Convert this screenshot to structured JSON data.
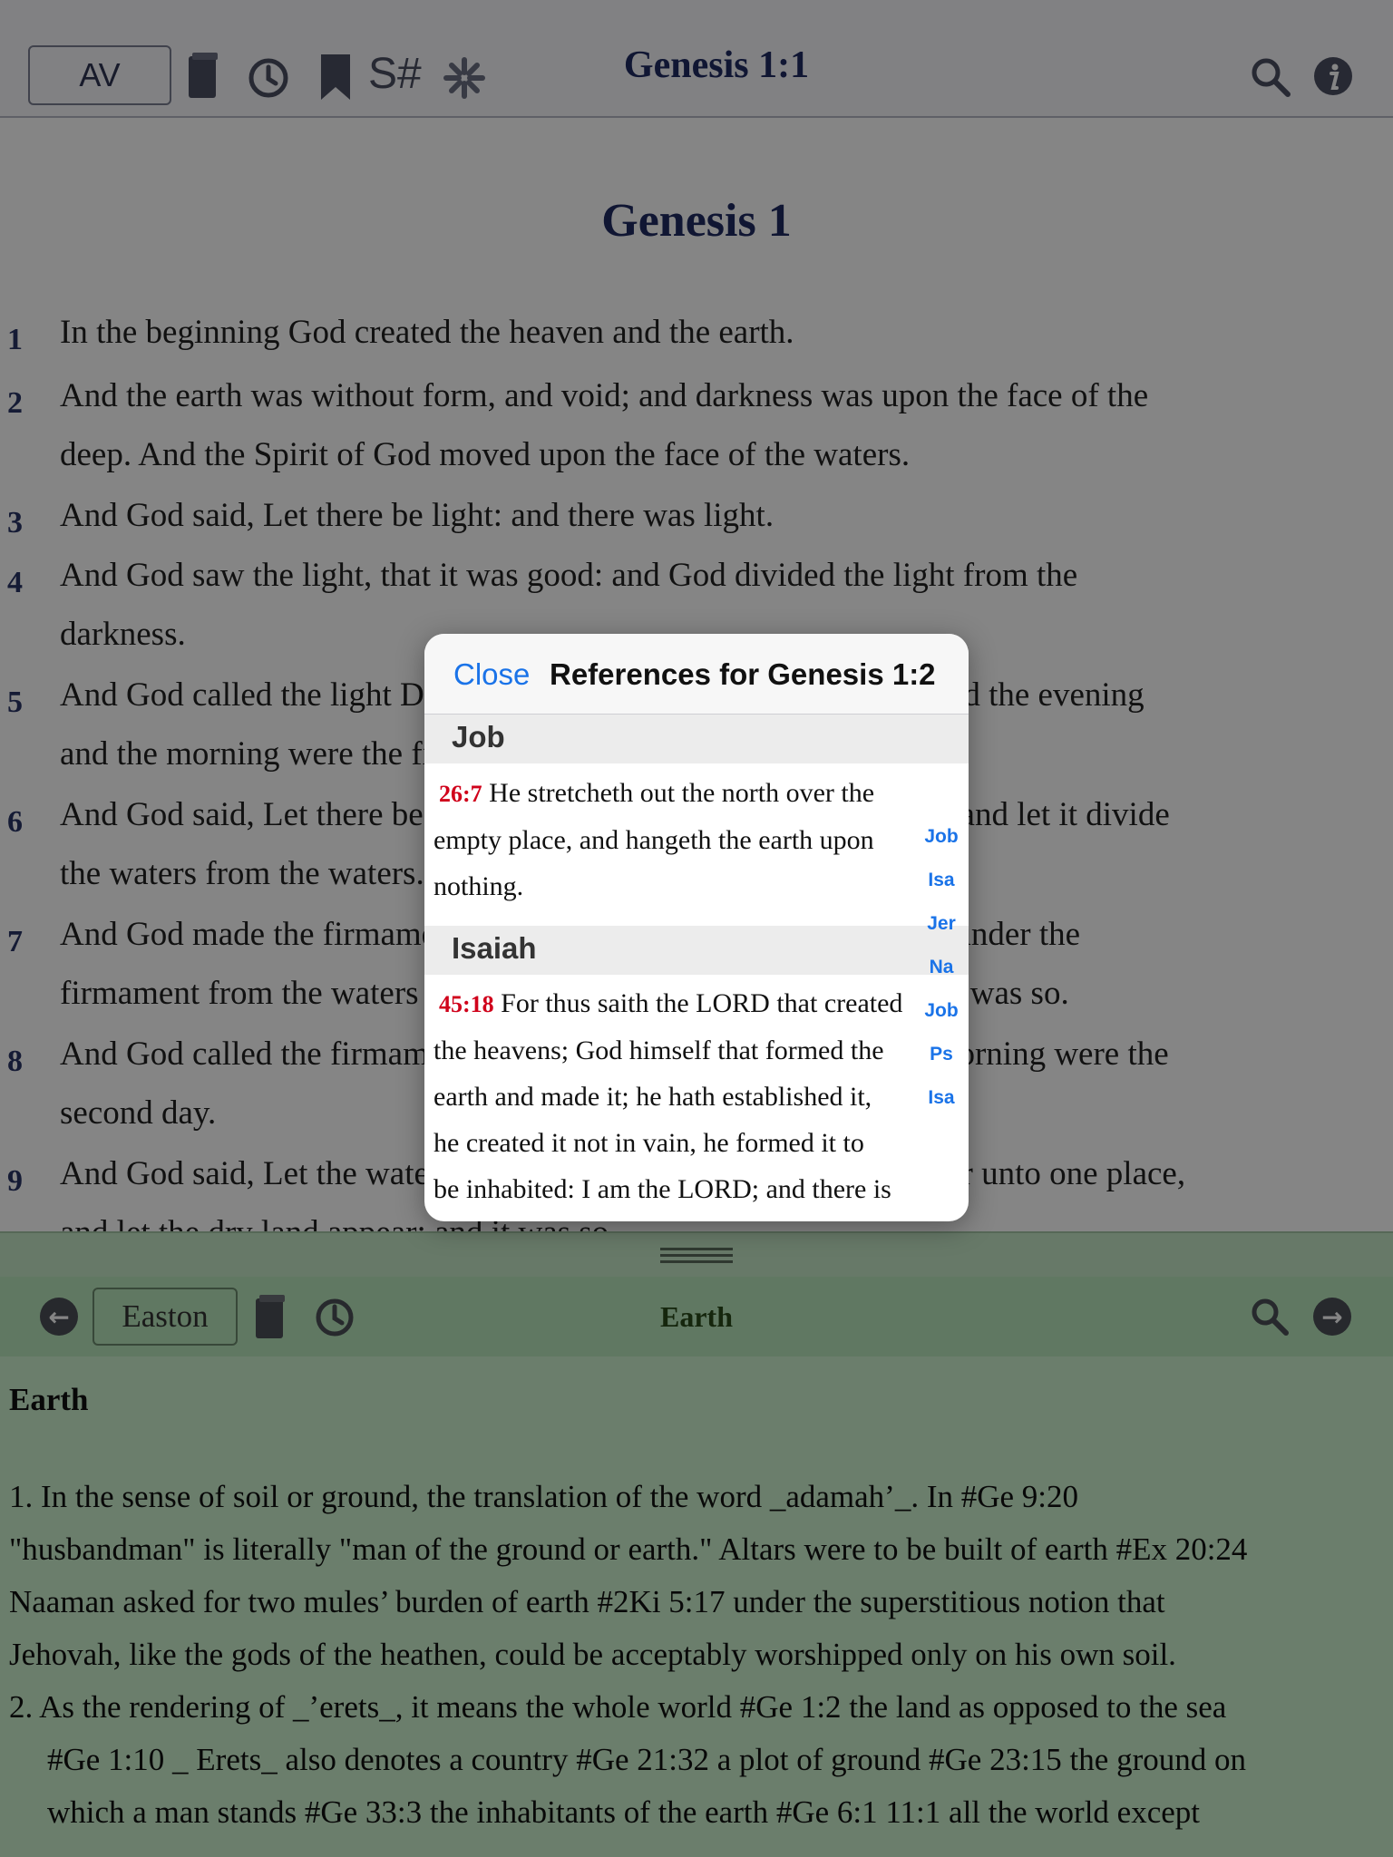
{
  "top_toolbar": {
    "version_label": "AV",
    "title": "Genesis 1:1",
    "icons": [
      "book-icon",
      "history-icon",
      "bookmark-icon",
      "strongs-icon",
      "asterisk-icon",
      "search-icon",
      "info-icon"
    ],
    "strongs_label": "S#"
  },
  "chapter": {
    "title": "Genesis 1",
    "verses": [
      {
        "num": "1",
        "lines": [
          "In the beginning God created the heaven and the earth."
        ]
      },
      {
        "num": "2",
        "lines": [
          "And the earth was without form, and void; and darkness was upon the face of the",
          "deep. And the Spirit of God moved upon the face of the waters."
        ]
      },
      {
        "num": "3",
        "lines": [
          "And God said, Let there be light: and there was light."
        ]
      },
      {
        "num": "4",
        "lines": [
          "And God saw the light, that it was good: and God divided the light from the",
          "darkness."
        ]
      },
      {
        "num": "5",
        "lines": [
          "And God called the light Day, and the darkness he called Night. And the evening",
          "and the morning were the first day."
        ]
      },
      {
        "num": "6",
        "lines": [
          "And God said, Let there be a firmament in the midst of the waters, and let it divide",
          "the waters from the waters."
        ]
      },
      {
        "num": "7",
        "lines": [
          "And God made the firmament, and divided the waters which were under the",
          "firmament from the waters which were above the firmament: and it was so."
        ]
      },
      {
        "num": "8",
        "lines": [
          "And God called the firmament Heaven. And the evening and the morning were the",
          "second day."
        ]
      },
      {
        "num": "9",
        "lines": [
          "And God said, Let the waters under the heaven be gathered together unto one place,",
          "and let the dry land appear: and it was so."
        ]
      }
    ]
  },
  "popup": {
    "close_label": "Close",
    "title": "References for Genesis 1:2",
    "sections": [
      {
        "book": "Job",
        "ref": "26:7",
        "lines": [
          "He stretcheth out the north over the",
          "empty place, and hangeth the earth upon",
          "nothing."
        ]
      },
      {
        "book": "Isaiah",
        "ref": "45:18",
        "lines": [
          "For thus saith the LORD that created",
          "the heavens; God himself that formed the",
          "earth and made it; he hath established it,",
          "he created it not in vain, he formed it to",
          "be inhabited: I am the LORD; and there is"
        ]
      }
    ],
    "index": [
      "Job",
      "Isa",
      "Jer",
      "Na",
      "Job",
      "Ps",
      "Isa"
    ]
  },
  "lower_toolbar": {
    "dictionary_label": "Easton",
    "title": "Earth",
    "icons": [
      "back-arrow-icon",
      "book-icon",
      "history-icon",
      "search-icon",
      "forward-arrow-icon"
    ]
  },
  "dictionary": {
    "heading": "Earth",
    "lines": [
      " 1. In the sense of soil or ground, the translation of the word _adamah’_. In #Ge 9:20",
      "\"husbandman\" is literally \"man of the ground or earth.\" Altars were to be built of earth #Ex 20:24",
      "Naaman asked for two mules’ burden of earth #2Ki 5:17 under the superstitious notion that",
      "Jehovah, like the gods of the heathen, could be acceptably worshipped only on his own soil.",
      " 2. As the rendering of _’erets_, it means the whole world #Ge 1:2 the land as opposed to the sea",
      "#Ge 1:10 _ Erets_ also denotes a country #Ge 21:32 a plot of ground #Ge 23:15 the ground on",
      "which a man stands #Ge 33:3 the inhabitants of the earth #Ge 6:1 11:1 all the world except"
    ]
  }
}
